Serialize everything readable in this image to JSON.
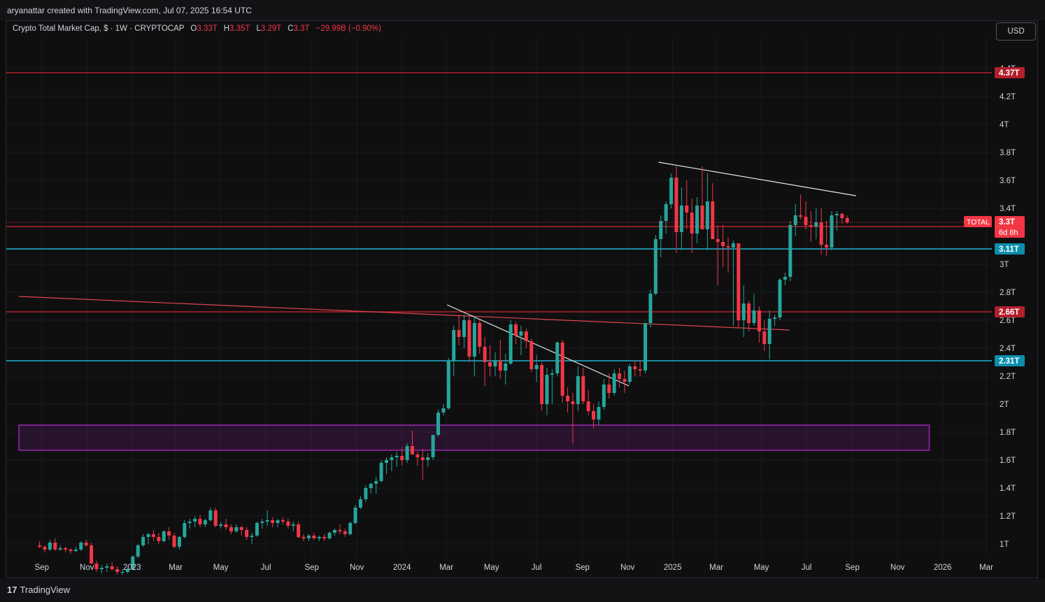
{
  "header": {
    "credit": "aryanattar created with TradingView.com, Jul 07, 2025 16:54 UTC",
    "usd_button": "USD"
  },
  "legend": {
    "symbol": "Crypto Total Market Cap, $ · 1W · CRYPTOCAP",
    "o_label": "O",
    "o_value": "3.33T",
    "h_label": "H",
    "h_value": "3.35T",
    "l_label": "L",
    "l_value": "3.29T",
    "c_label": "C",
    "c_value": "3.3T",
    "change": "−29.99B (−0.90%)"
  },
  "footer": {
    "logo_mark": "17",
    "logo_text": "TradingView"
  },
  "colors": {
    "bull": "#26a69a",
    "bear": "#f23645",
    "resistance": "#b2202c",
    "support": "#22b3d1",
    "zone": "#9c27b0",
    "background": "#0f0f10"
  },
  "chart_data": {
    "type": "candlestick",
    "title": "Crypto Total Market Cap",
    "interval": "1W",
    "y_unit": "T",
    "ylim": [
      0.95,
      4.5
    ],
    "y_ticks": [
      1.0,
      1.2,
      1.4,
      1.6,
      1.8,
      2.0,
      2.2,
      2.4,
      2.6,
      2.8,
      3.0,
      3.4,
      3.6,
      3.8,
      4.0,
      4.2,
      4.4
    ],
    "y_tick_labels": [
      "1T",
      "1.2T",
      "1.4T",
      "1.6T",
      "1.8T",
      "2T",
      "2.2T",
      "2.4T",
      "2.6T",
      "2.8T",
      "3T",
      "3.4T",
      "3.6T",
      "3.8T",
      "4T",
      "4.2T",
      "4.4T"
    ],
    "x_ticks": [
      {
        "label": "Sep",
        "date": "2022-09-01"
      },
      {
        "label": "Nov",
        "date": "2022-11-01"
      },
      {
        "label": "2023",
        "date": "2023-01-01"
      },
      {
        "label": "Mar",
        "date": "2023-03-01"
      },
      {
        "label": "May",
        "date": "2023-05-01"
      },
      {
        "label": "Jul",
        "date": "2023-07-01"
      },
      {
        "label": "Sep",
        "date": "2023-09-01"
      },
      {
        "label": "Nov",
        "date": "2023-11-01"
      },
      {
        "label": "2024",
        "date": "2024-01-01"
      },
      {
        "label": "Mar",
        "date": "2024-03-01"
      },
      {
        "label": "May",
        "date": "2024-05-01"
      },
      {
        "label": "Jul",
        "date": "2024-07-01"
      },
      {
        "label": "Sep",
        "date": "2024-09-01"
      },
      {
        "label": "Nov",
        "date": "2024-11-01"
      },
      {
        "label": "2025",
        "date": "2025-01-01"
      },
      {
        "label": "Mar",
        "date": "2025-03-01"
      },
      {
        "label": "May",
        "date": "2025-05-01"
      },
      {
        "label": "Jul",
        "date": "2025-07-01"
      },
      {
        "label": "Sep",
        "date": "2025-09-01"
      },
      {
        "label": "Nov",
        "date": "2025-11-01"
      },
      {
        "label": "2026",
        "date": "2026-01-01"
      },
      {
        "label": "Mar",
        "date": "2026-03-01"
      }
    ],
    "first_candle": "2022-08-29",
    "candles": [
      [
        0.99,
        1.02,
        0.97,
        0.98
      ],
      [
        0.98,
        0.99,
        0.94,
        0.96
      ],
      [
        0.96,
        1.03,
        0.95,
        1.01
      ],
      [
        1.01,
        1.04,
        0.95,
        0.96
      ],
      [
        0.96,
        0.99,
        0.95,
        0.97
      ],
      [
        0.97,
        0.98,
        0.94,
        0.96
      ],
      [
        0.96,
        0.97,
        0.93,
        0.95
      ],
      [
        0.95,
        0.98,
        0.94,
        0.96
      ],
      [
        0.96,
        1.02,
        0.95,
        1.01
      ],
      [
        1.01,
        1.03,
        0.98,
        0.99
      ],
      [
        0.99,
        1.01,
        0.86,
        0.86
      ],
      [
        0.86,
        0.88,
        0.8,
        0.82
      ],
      [
        0.82,
        0.85,
        0.79,
        0.83
      ],
      [
        0.83,
        0.86,
        0.8,
        0.84
      ],
      [
        0.84,
        0.87,
        0.81,
        0.82
      ],
      [
        0.82,
        0.84,
        0.78,
        0.8
      ],
      [
        0.8,
        0.82,
        0.78,
        0.8
      ],
      [
        0.8,
        0.83,
        0.79,
        0.82
      ],
      [
        0.82,
        0.92,
        0.81,
        0.91
      ],
      [
        0.91,
        1.0,
        0.9,
        0.99
      ],
      [
        0.99,
        1.07,
        0.98,
        1.05
      ],
      [
        1.05,
        1.08,
        1.0,
        1.07
      ],
      [
        1.07,
        1.1,
        1.02,
        1.05
      ],
      [
        1.05,
        1.08,
        1.0,
        1.02
      ],
      [
        1.02,
        1.1,
        1.01,
        1.09
      ],
      [
        1.09,
        1.12,
        1.03,
        1.06
      ],
      [
        1.06,
        1.08,
        0.97,
        0.98
      ],
      [
        0.98,
        1.06,
        0.96,
        1.05
      ],
      [
        1.05,
        1.17,
        1.04,
        1.15
      ],
      [
        1.15,
        1.18,
        1.11,
        1.16
      ],
      [
        1.16,
        1.2,
        1.12,
        1.18
      ],
      [
        1.18,
        1.21,
        1.12,
        1.14
      ],
      [
        1.14,
        1.18,
        1.12,
        1.17
      ],
      [
        1.17,
        1.26,
        1.16,
        1.24
      ],
      [
        1.24,
        1.26,
        1.12,
        1.13
      ],
      [
        1.13,
        1.16,
        1.11,
        1.14
      ],
      [
        1.14,
        1.18,
        1.1,
        1.12
      ],
      [
        1.12,
        1.14,
        1.07,
        1.09
      ],
      [
        1.09,
        1.14,
        1.08,
        1.12
      ],
      [
        1.12,
        1.13,
        1.06,
        1.1
      ],
      [
        1.1,
        1.12,
        1.03,
        1.05
      ],
      [
        1.05,
        1.08,
        1.0,
        1.06
      ],
      [
        1.06,
        1.16,
        1.05,
        1.15
      ],
      [
        1.15,
        1.18,
        1.11,
        1.16
      ],
      [
        1.16,
        1.24,
        1.13,
        1.17
      ],
      [
        1.17,
        1.19,
        1.12,
        1.15
      ],
      [
        1.15,
        1.18,
        1.12,
        1.17
      ],
      [
        1.17,
        1.19,
        1.14,
        1.16
      ],
      [
        1.16,
        1.18,
        1.11,
        1.13
      ],
      [
        1.13,
        1.16,
        1.09,
        1.14
      ],
      [
        1.14,
        1.16,
        1.04,
        1.05
      ],
      [
        1.05,
        1.07,
        1.02,
        1.04
      ],
      [
        1.04,
        1.07,
        1.02,
        1.06
      ],
      [
        1.06,
        1.08,
        1.03,
        1.04
      ],
      [
        1.04,
        1.06,
        1.02,
        1.05
      ],
      [
        1.05,
        1.07,
        1.02,
        1.04
      ],
      [
        1.04,
        1.09,
        1.03,
        1.08
      ],
      [
        1.08,
        1.11,
        1.06,
        1.1
      ],
      [
        1.1,
        1.14,
        1.07,
        1.09
      ],
      [
        1.09,
        1.11,
        1.05,
        1.07
      ],
      [
        1.07,
        1.16,
        1.06,
        1.15
      ],
      [
        1.15,
        1.28,
        1.14,
        1.26
      ],
      [
        1.26,
        1.34,
        1.25,
        1.32
      ],
      [
        1.32,
        1.42,
        1.3,
        1.4
      ],
      [
        1.4,
        1.44,
        1.36,
        1.43
      ],
      [
        1.43,
        1.48,
        1.36,
        1.45
      ],
      [
        1.45,
        1.6,
        1.44,
        1.58
      ],
      [
        1.58,
        1.62,
        1.5,
        1.6
      ],
      [
        1.6,
        1.64,
        1.52,
        1.62
      ],
      [
        1.62,
        1.66,
        1.55,
        1.63
      ],
      [
        1.63,
        1.69,
        1.56,
        1.6
      ],
      [
        1.6,
        1.72,
        1.58,
        1.7
      ],
      [
        1.7,
        1.81,
        1.64,
        1.64
      ],
      [
        1.64,
        1.66,
        1.56,
        1.62
      ],
      [
        1.62,
        1.68,
        1.46,
        1.6
      ],
      [
        1.6,
        1.65,
        1.55,
        1.62
      ],
      [
        1.62,
        1.78,
        1.6,
        1.78
      ],
      [
        1.78,
        1.96,
        1.77,
        1.94
      ],
      [
        1.94,
        2.0,
        1.92,
        1.97
      ],
      [
        1.97,
        2.33,
        1.96,
        2.31
      ],
      [
        2.31,
        2.56,
        2.2,
        2.53
      ],
      [
        2.53,
        2.64,
        2.42,
        2.48
      ],
      [
        2.48,
        2.64,
        2.4,
        2.6
      ],
      [
        2.6,
        2.64,
        2.3,
        2.34
      ],
      [
        2.34,
        2.63,
        2.2,
        2.58
      ],
      [
        2.58,
        2.6,
        2.36,
        2.41
      ],
      [
        2.41,
        2.48,
        2.13,
        2.3
      ],
      [
        2.3,
        2.42,
        2.2,
        2.27
      ],
      [
        2.27,
        2.37,
        2.2,
        2.31
      ],
      [
        2.31,
        2.46,
        2.18,
        2.24
      ],
      [
        2.24,
        2.36,
        2.14,
        2.29
      ],
      [
        2.29,
        2.6,
        2.28,
        2.57
      ],
      [
        2.57,
        2.59,
        2.43,
        2.49
      ],
      [
        2.49,
        2.56,
        2.35,
        2.52
      ],
      [
        2.52,
        2.54,
        2.4,
        2.45
      ],
      [
        2.45,
        2.47,
        2.23,
        2.25
      ],
      [
        2.25,
        2.35,
        2.16,
        2.28
      ],
      [
        2.28,
        2.3,
        1.95,
        2.0
      ],
      [
        2.0,
        2.26,
        1.92,
        2.21
      ],
      [
        2.21,
        2.25,
        2.0,
        2.22
      ],
      [
        2.22,
        2.45,
        2.2,
        2.44
      ],
      [
        2.44,
        2.46,
        2.01,
        2.06
      ],
      [
        2.06,
        2.12,
        1.94,
        2.02
      ],
      [
        2.02,
        2.08,
        1.72,
        2.0
      ],
      [
        2.0,
        2.27,
        1.95,
        2.2
      ],
      [
        2.2,
        2.26,
        2.0,
        2.02
      ],
      [
        2.02,
        2.1,
        1.92,
        1.95
      ],
      [
        1.95,
        2.0,
        1.83,
        1.89
      ],
      [
        1.89,
        2.02,
        1.85,
        1.98
      ],
      [
        1.98,
        2.18,
        1.96,
        2.14
      ],
      [
        2.14,
        2.22,
        2.04,
        2.08
      ],
      [
        2.08,
        2.25,
        2.06,
        2.22
      ],
      [
        2.22,
        2.26,
        2.12,
        2.18
      ],
      [
        2.18,
        2.24,
        2.08,
        2.16
      ],
      [
        2.16,
        2.29,
        2.14,
        2.27
      ],
      [
        2.27,
        2.31,
        2.2,
        2.25
      ],
      [
        2.25,
        2.31,
        2.2,
        2.24
      ],
      [
        2.24,
        2.42,
        2.22,
        2.58
      ],
      [
        2.58,
        2.82,
        2.55,
        2.79
      ],
      [
        2.79,
        3.21,
        2.78,
        3.18
      ],
      [
        3.18,
        3.35,
        3.05,
        3.31
      ],
      [
        3.31,
        3.45,
        3.22,
        3.43
      ],
      [
        3.43,
        3.65,
        3.4,
        3.62
      ],
      [
        3.62,
        3.7,
        3.08,
        3.23
      ],
      [
        3.23,
        3.55,
        3.1,
        3.42
      ],
      [
        3.42,
        3.6,
        3.25,
        3.37
      ],
      [
        3.37,
        3.47,
        3.08,
        3.22
      ],
      [
        3.22,
        3.48,
        3.15,
        3.42
      ],
      [
        3.42,
        3.7,
        3.28,
        3.25
      ],
      [
        3.25,
        3.65,
        3.1,
        3.45
      ],
      [
        3.45,
        3.58,
        3.2,
        3.18
      ],
      [
        3.18,
        3.28,
        2.85,
        3.16
      ],
      [
        3.16,
        3.28,
        2.98,
        3.13
      ],
      [
        3.13,
        3.19,
        2.94,
        3.12
      ],
      [
        3.12,
        3.17,
        2.56,
        3.15
      ],
      [
        3.15,
        3.12,
        2.55,
        2.6
      ],
      [
        2.6,
        2.85,
        2.48,
        2.72
      ],
      [
        2.72,
        2.74,
        2.52,
        2.58
      ],
      [
        2.58,
        2.79,
        2.56,
        2.67
      ],
      [
        2.67,
        2.7,
        2.44,
        2.52
      ],
      [
        2.52,
        2.6,
        2.38,
        2.43
      ],
      [
        2.43,
        2.67,
        2.32,
        2.61
      ],
      [
        2.61,
        2.64,
        2.56,
        2.62
      ],
      [
        2.62,
        2.9,
        2.6,
        2.89
      ],
      [
        2.89,
        2.94,
        2.85,
        2.91
      ],
      [
        2.91,
        3.31,
        2.88,
        3.28
      ],
      [
        3.28,
        3.43,
        3.2,
        3.35
      ],
      [
        3.35,
        3.5,
        3.32,
        3.34
      ],
      [
        3.34,
        3.45,
        3.25,
        3.28
      ],
      [
        3.28,
        3.38,
        3.16,
        3.27
      ],
      [
        3.27,
        3.4,
        3.18,
        3.3
      ],
      [
        3.3,
        3.4,
        3.07,
        3.14
      ],
      [
        3.14,
        3.31,
        3.06,
        3.12
      ],
      [
        3.12,
        3.38,
        3.1,
        3.35
      ],
      [
        3.35,
        3.38,
        3.24,
        3.36
      ],
      [
        3.36,
        3.37,
        3.29,
        3.33
      ],
      [
        3.33,
        3.35,
        3.29,
        3.3
      ]
    ],
    "horizontal_levels": [
      {
        "value": 4.37,
        "label": "4.37T",
        "color": "#b2202c"
      },
      {
        "value": 3.27,
        "label": "3.27T",
        "color": "#b2202c"
      },
      {
        "value": 3.11,
        "label": "3.11T",
        "color": "#22b3d1"
      },
      {
        "value": 2.66,
        "label": "2.66T",
        "color": "#b2202c"
      },
      {
        "value": 2.31,
        "label": "2.31T",
        "color": "#22b3d1"
      }
    ],
    "current_price": {
      "value": 3.3,
      "label": "3.3T",
      "symbol": "TOTAL",
      "countdown": "6d 8h"
    },
    "trendlines": [
      {
        "from": [
          "2022-08-01",
          2.77
        ],
        "to": [
          "2025-06-08",
          2.53
        ],
        "color": "#e0454f"
      },
      {
        "from": [
          "2024-03-02",
          2.71
        ],
        "to": [
          "2024-11-03",
          2.13
        ],
        "color": "#e6e6e6"
      },
      {
        "from": [
          "2024-12-13",
          3.73
        ],
        "to": [
          "2025-09-06",
          3.49
        ],
        "color": "#e6e6e6"
      }
    ],
    "zone": {
      "from": "2022-08-01",
      "to": "2025-12-14",
      "low": 1.67,
      "high": 1.85,
      "color": "#9c27b0"
    }
  }
}
